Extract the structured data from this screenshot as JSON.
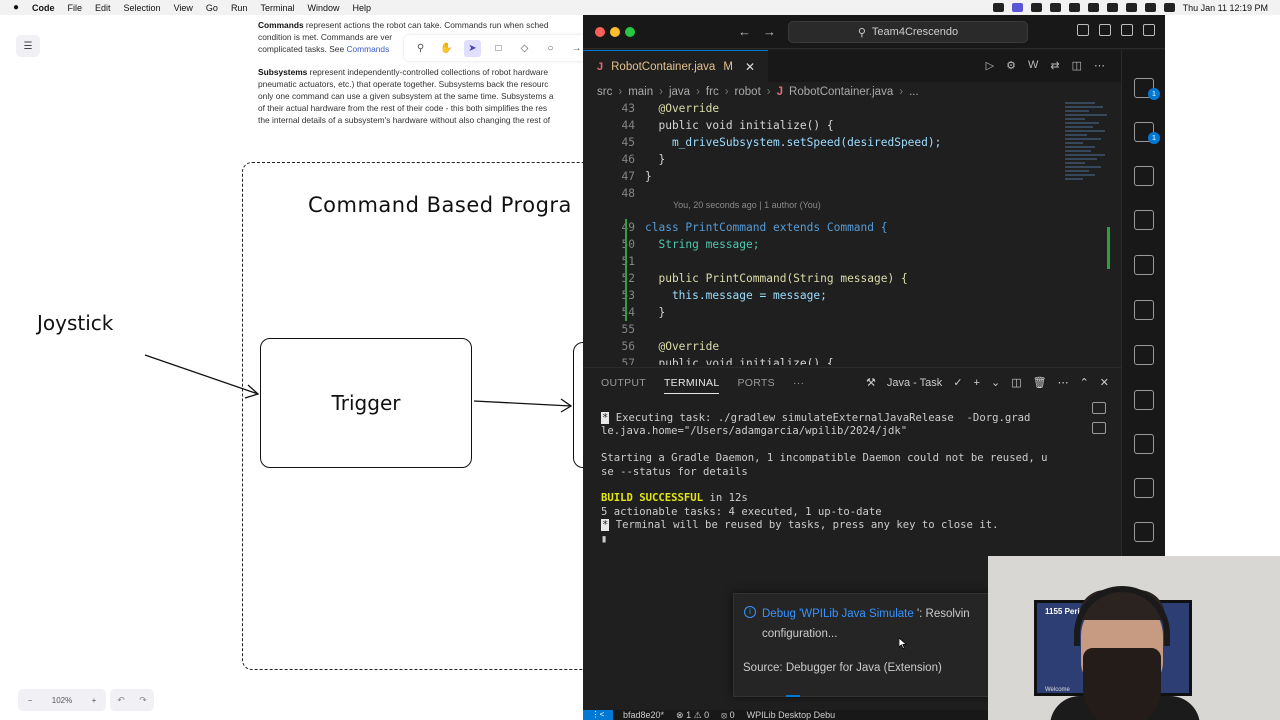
{
  "menubar": {
    "apple": "",
    "items": [
      "Code",
      "File",
      "Edit",
      "Selection",
      "View",
      "Go",
      "Run",
      "Terminal",
      "Window",
      "Help"
    ],
    "clock": "Thu Jan 11  12:19 PM"
  },
  "whiteboard": {
    "doc_lines": [
      {
        "bold": "Commands",
        "text": " represent actions the robot can take. Commands run when sched"
      },
      {
        "text": "condition is met. Commands are ver"
      },
      {
        "text": "complicated tasks. See ",
        "link": "Commands"
      }
    ],
    "doc_para2": [
      {
        "bold": "Subsystems",
        "text": " represent independently-controlled collections of robot hardware"
      },
      {
        "text": "pneumatic actuators, etc.) that operate together. Subsystems back the resourc"
      },
      {
        "text": "only one command can use a given subsystem at the same time. Subsystems a"
      },
      {
        "text": "of their actual hardware from the rest of their code - this both simplifies the res"
      },
      {
        "text": "the internal details of a subsystem's hardware without also changing the rest of"
      }
    ],
    "title": "Command Based Progra",
    "joystick_label": "Joystick",
    "trigger_label": "Trigger",
    "zoom": "102%",
    "zoom_minus": "−",
    "zoom_plus": "+"
  },
  "vscode": {
    "window_title": "Team4Crescendo",
    "tab": {
      "icon": "J",
      "name": "RobotContainer.java",
      "status": "M",
      "close": "✕"
    },
    "breadcrumb": [
      "src",
      "main",
      "java",
      "frc",
      "robot",
      "RobotContainer.java",
      "..."
    ],
    "blame": "You, 20 seconds ago | 1 author (You)",
    "code_lines": [
      {
        "n": "43",
        "text": "  @Override"
      },
      {
        "n": "44",
        "text": "  public void initialize() {"
      },
      {
        "n": "45",
        "text": "    m_driveSubsystem.setSpeed(desiredSpeed);"
      },
      {
        "n": "46",
        "text": "  }"
      },
      {
        "n": "47",
        "text": "}"
      },
      {
        "n": "48",
        "text": ""
      },
      {
        "n": "49",
        "text": "class PrintCommand extends Command {"
      },
      {
        "n": "50",
        "text": "  String message;"
      },
      {
        "n": "51",
        "text": ""
      },
      {
        "n": "52",
        "text": "  public PrintCommand(String message) {"
      },
      {
        "n": "53",
        "text": "    this.message = message;"
      },
      {
        "n": "54",
        "text": "  }"
      },
      {
        "n": "55",
        "text": ""
      },
      {
        "n": "56",
        "text": "  @Override"
      },
      {
        "n": "57",
        "text": "  public void initialize() {"
      }
    ],
    "panel_tabs": [
      "OUTPUT",
      "TERMINAL",
      "PORTS",
      "···"
    ],
    "panel_active": "TERMINAL",
    "task_label": "Java - Task",
    "terminal": {
      "l1": " Executing task: ./gradlew simulateExternalJavaRelease  -Dorg.grad",
      "l2": "le.java.home=\"/Users/adamgarcia/wpilib/2024/jdk\"",
      "l3": "Starting a Gradle Daemon, 1 incompatible Daemon could not be reused, u",
      "l4": "se --status for details",
      "l5": "BUILD SUCCESSFUL",
      "l5b": " in 12s",
      "l6": "5 actionable tasks: 4 executed, 1 up-to-date",
      "l7": " Terminal will be reused by tasks, press any key to close it."
    },
    "notification": {
      "link_text": "Debug 'WPILib Java Simulate",
      "rest": " ': Resolvin",
      "line2": "configuration...",
      "source": "Source: Debugger for Java (Extension)"
    },
    "status": {
      "branch": "bfad8e20*",
      "problems": "⊗ 1 ⚠ 0",
      "ports": "⦻ 0",
      "target": "WPILib Desktop Debu"
    }
  },
  "webcam": {
    "tv_title": "1155 Perimeter C",
    "tv_footer": "Welcome"
  },
  "colors": {
    "accent": "#0078d4",
    "editor_bg": "#1f1f1f",
    "build_success": "#e5e510",
    "link": "#3794ff"
  }
}
